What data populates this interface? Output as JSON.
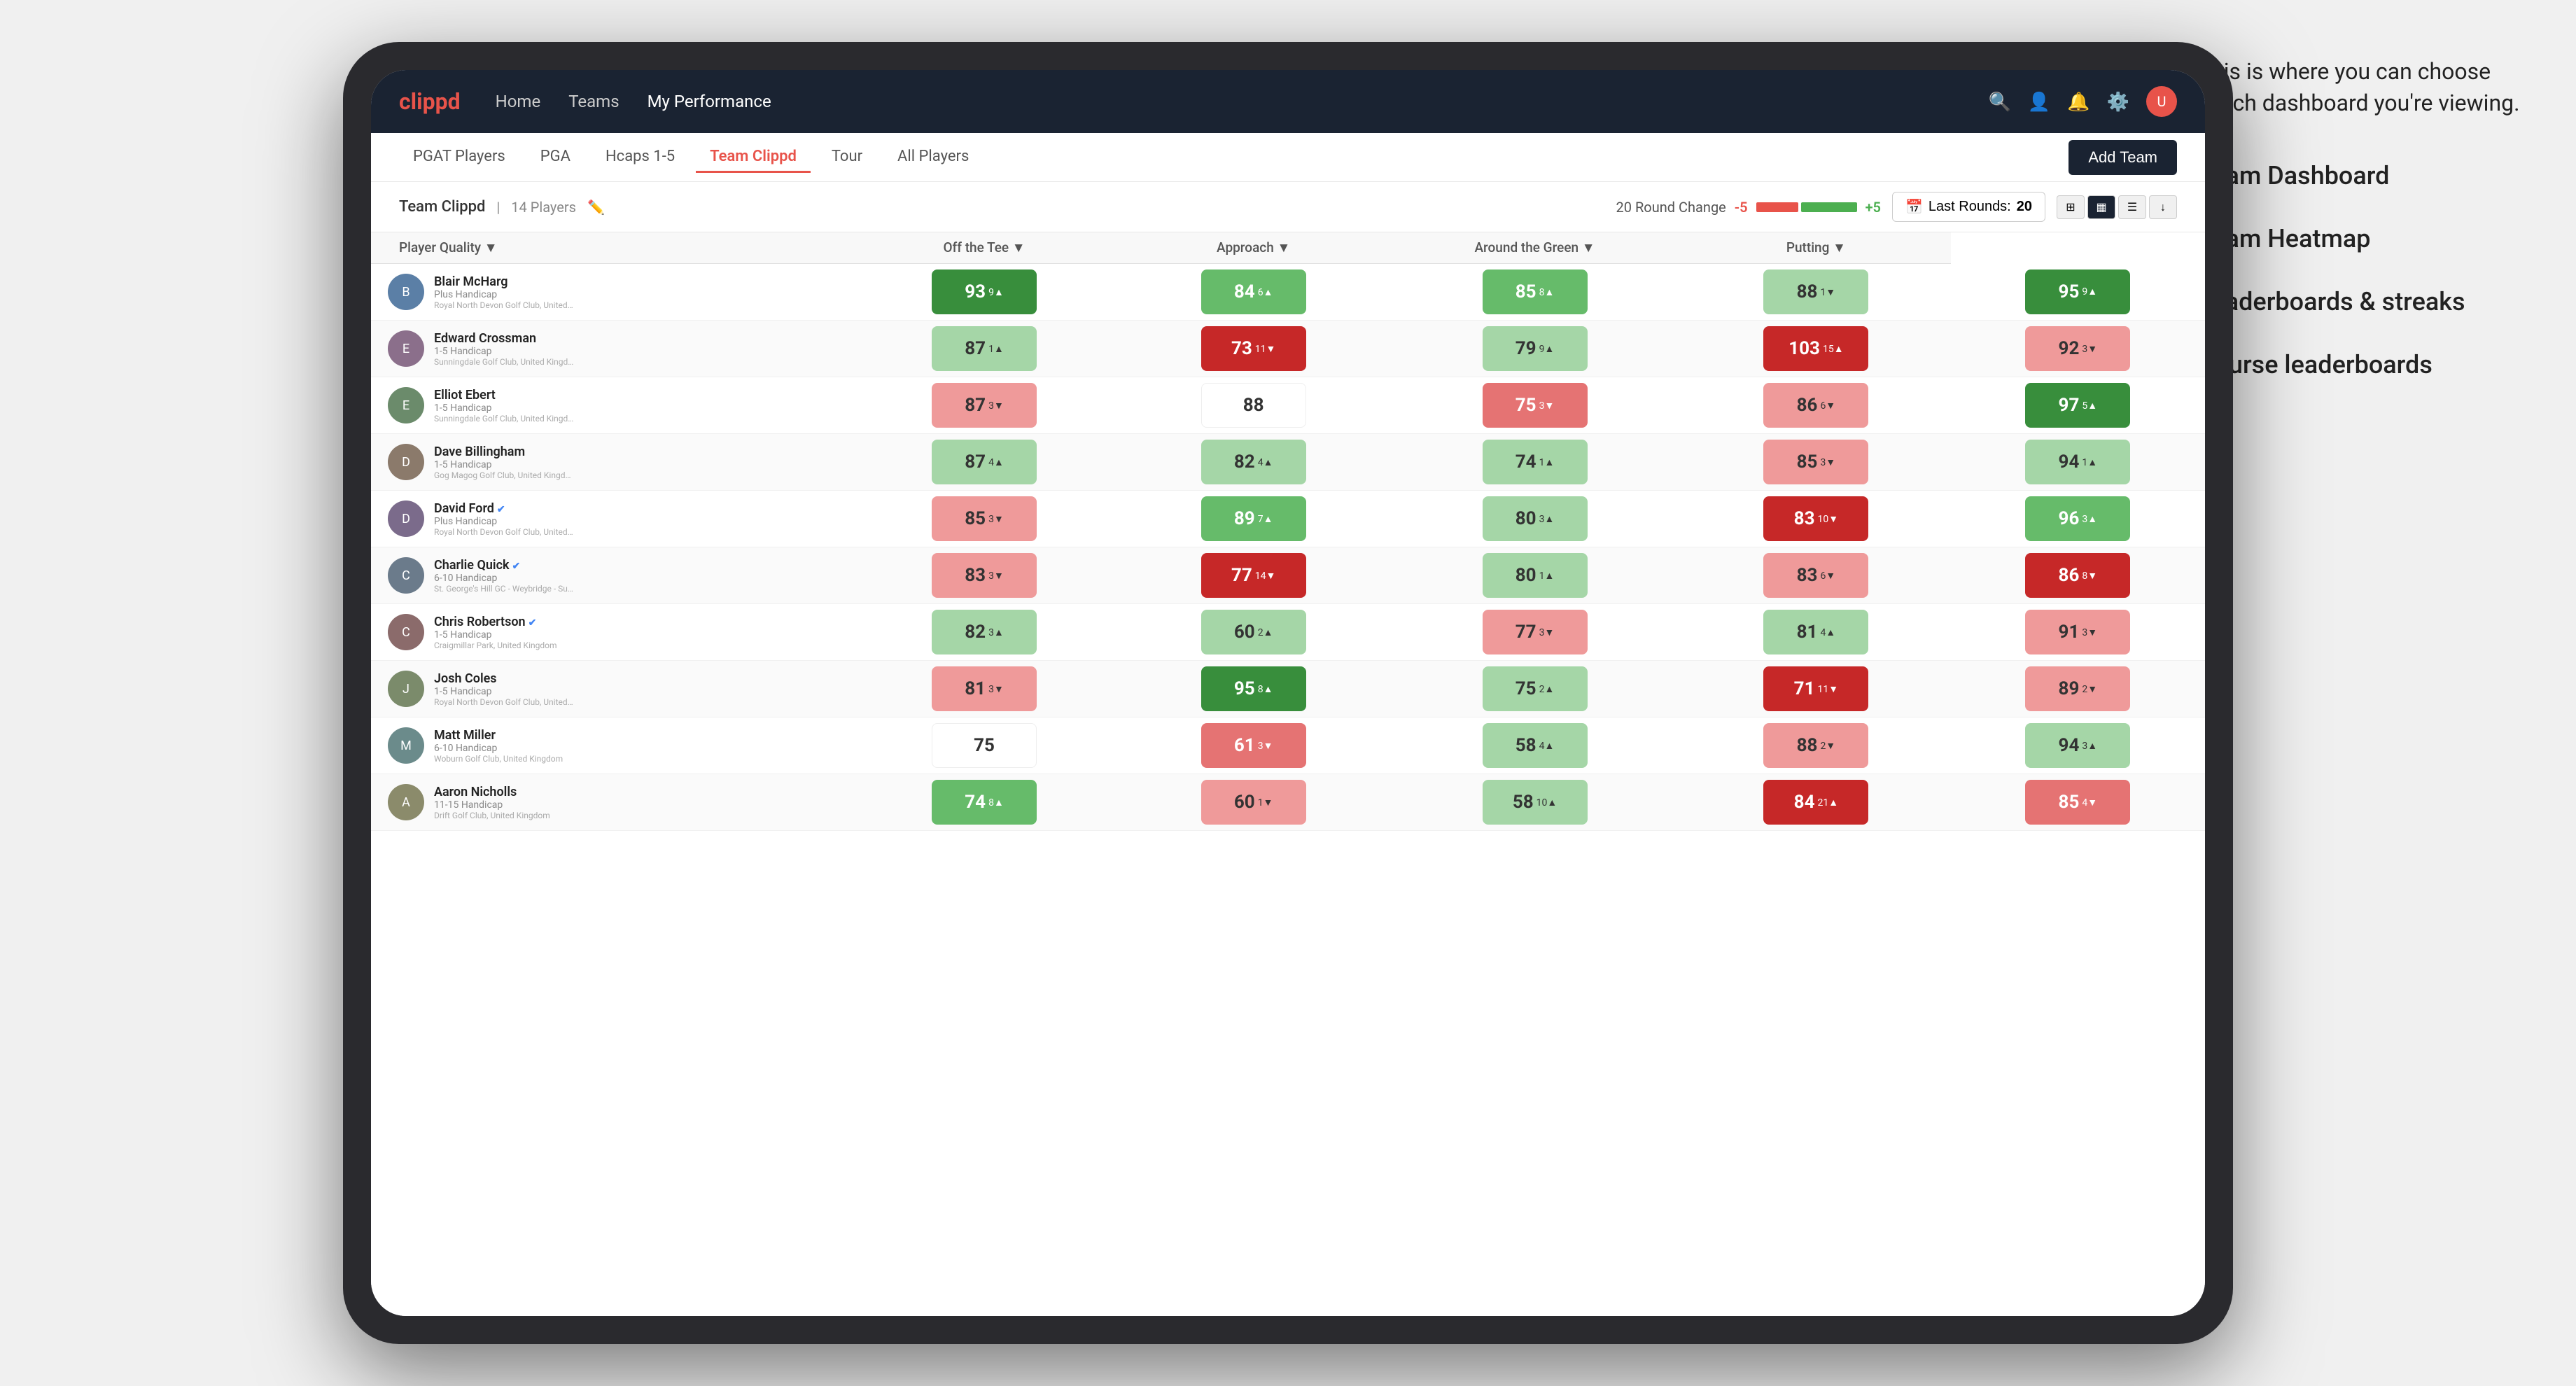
{
  "annotation": {
    "callout": "This is where you can choose which dashboard you're viewing.",
    "items": [
      "Team Dashboard",
      "Team Heatmap",
      "Leaderboards & streaks",
      "Course leaderboards"
    ]
  },
  "nav": {
    "logo": "clippd",
    "links": [
      "Home",
      "Teams",
      "My Performance"
    ],
    "active_link": "My Performance"
  },
  "sub_nav": {
    "tabs": [
      "PGAT Players",
      "PGA",
      "Hcaps 1-5",
      "Team Clippd",
      "Tour",
      "All Players"
    ],
    "active_tab": "Team Clippd",
    "add_team_label": "Add Team"
  },
  "team_header": {
    "name": "Team Clippd",
    "separator": "|",
    "count": "14 Players",
    "round_change_label": "20 Round Change",
    "round_change_neg": "-5",
    "round_change_pos": "+5",
    "last_rounds_label": "Last Rounds:",
    "last_rounds_value": "20"
  },
  "table": {
    "columns": [
      "Player Quality ▼",
      "Off the Tee ▼",
      "Approach ▼",
      "Around the Green ▼",
      "Putting ▼"
    ],
    "player_col": "Player Quality ▼",
    "rows": [
      {
        "name": "Blair McHarg",
        "handicap": "Plus Handicap",
        "club": "Royal North Devon Golf Club, United Kingdom",
        "metrics": [
          {
            "value": "93",
            "change": "9",
            "dir": "up",
            "color": "green-dark"
          },
          {
            "value": "84",
            "change": "6",
            "dir": "up",
            "color": "green-med"
          },
          {
            "value": "85",
            "change": "8",
            "dir": "up",
            "color": "green-med"
          },
          {
            "value": "88",
            "change": "1",
            "dir": "down",
            "color": "green-light"
          },
          {
            "value": "95",
            "change": "9",
            "dir": "up",
            "color": "green-dark"
          }
        ]
      },
      {
        "name": "Edward Crossman",
        "handicap": "1-5 Handicap",
        "club": "Sunningdale Golf Club, United Kingdom",
        "metrics": [
          {
            "value": "87",
            "change": "1",
            "dir": "up",
            "color": "green-light"
          },
          {
            "value": "73",
            "change": "11",
            "dir": "down",
            "color": "red-dark"
          },
          {
            "value": "79",
            "change": "9",
            "dir": "up",
            "color": "green-light"
          },
          {
            "value": "103",
            "change": "15",
            "dir": "up",
            "color": "red-dark"
          },
          {
            "value": "92",
            "change": "3",
            "dir": "down",
            "color": "red-light"
          }
        ]
      },
      {
        "name": "Elliot Ebert",
        "handicap": "1-5 Handicap",
        "club": "Sunningdale Golf Club, United Kingdom",
        "metrics": [
          {
            "value": "87",
            "change": "3",
            "dir": "down",
            "color": "red-light"
          },
          {
            "value": "88",
            "change": "",
            "dir": "",
            "color": "white-cell"
          },
          {
            "value": "75",
            "change": "3",
            "dir": "down",
            "color": "red-med"
          },
          {
            "value": "86",
            "change": "6",
            "dir": "down",
            "color": "red-light"
          },
          {
            "value": "97",
            "change": "5",
            "dir": "up",
            "color": "green-dark"
          }
        ]
      },
      {
        "name": "Dave Billingham",
        "handicap": "1-5 Handicap",
        "club": "Gog Magog Golf Club, United Kingdom",
        "metrics": [
          {
            "value": "87",
            "change": "4",
            "dir": "up",
            "color": "green-light"
          },
          {
            "value": "82",
            "change": "4",
            "dir": "up",
            "color": "green-light"
          },
          {
            "value": "74",
            "change": "1",
            "dir": "up",
            "color": "green-light"
          },
          {
            "value": "85",
            "change": "3",
            "dir": "down",
            "color": "red-light"
          },
          {
            "value": "94",
            "change": "1",
            "dir": "up",
            "color": "green-light"
          }
        ]
      },
      {
        "name": "David Ford",
        "verified": true,
        "handicap": "Plus Handicap",
        "club": "Royal North Devon Golf Club, United Kingdom",
        "metrics": [
          {
            "value": "85",
            "change": "3",
            "dir": "down",
            "color": "red-light"
          },
          {
            "value": "89",
            "change": "7",
            "dir": "up",
            "color": "green-med"
          },
          {
            "value": "80",
            "change": "3",
            "dir": "up",
            "color": "green-light"
          },
          {
            "value": "83",
            "change": "10",
            "dir": "down",
            "color": "red-dark"
          },
          {
            "value": "96",
            "change": "3",
            "dir": "up",
            "color": "green-med"
          }
        ]
      },
      {
        "name": "Charlie Quick",
        "verified": true,
        "handicap": "6-10 Handicap",
        "club": "St. George's Hill GC - Weybridge - Surrey, Uni...",
        "metrics": [
          {
            "value": "83",
            "change": "3",
            "dir": "down",
            "color": "red-light"
          },
          {
            "value": "77",
            "change": "14",
            "dir": "down",
            "color": "red-dark"
          },
          {
            "value": "80",
            "change": "1",
            "dir": "up",
            "color": "green-light"
          },
          {
            "value": "83",
            "change": "6",
            "dir": "down",
            "color": "red-light"
          },
          {
            "value": "86",
            "change": "8",
            "dir": "down",
            "color": "red-dark"
          }
        ]
      },
      {
        "name": "Chris Robertson",
        "verified": true,
        "handicap": "1-5 Handicap",
        "club": "Craigmillar Park, United Kingdom",
        "metrics": [
          {
            "value": "82",
            "change": "3",
            "dir": "up",
            "color": "green-light"
          },
          {
            "value": "60",
            "change": "2",
            "dir": "up",
            "color": "green-light"
          },
          {
            "value": "77",
            "change": "3",
            "dir": "down",
            "color": "red-light"
          },
          {
            "value": "81",
            "change": "4",
            "dir": "up",
            "color": "green-light"
          },
          {
            "value": "91",
            "change": "3",
            "dir": "down",
            "color": "red-light"
          }
        ]
      },
      {
        "name": "Josh Coles",
        "handicap": "1-5 Handicap",
        "club": "Royal North Devon Golf Club, United Kingdom",
        "metrics": [
          {
            "value": "81",
            "change": "3",
            "dir": "down",
            "color": "red-light"
          },
          {
            "value": "95",
            "change": "8",
            "dir": "up",
            "color": "green-dark"
          },
          {
            "value": "75",
            "change": "2",
            "dir": "up",
            "color": "green-light"
          },
          {
            "value": "71",
            "change": "11",
            "dir": "down",
            "color": "red-dark"
          },
          {
            "value": "89",
            "change": "2",
            "dir": "down",
            "color": "red-light"
          }
        ]
      },
      {
        "name": "Matt Miller",
        "handicap": "6-10 Handicap",
        "club": "Woburn Golf Club, United Kingdom",
        "metrics": [
          {
            "value": "75",
            "change": "",
            "dir": "",
            "color": "white-cell"
          },
          {
            "value": "61",
            "change": "3",
            "dir": "down",
            "color": "red-med"
          },
          {
            "value": "58",
            "change": "4",
            "dir": "up",
            "color": "green-light"
          },
          {
            "value": "88",
            "change": "2",
            "dir": "down",
            "color": "red-light"
          },
          {
            "value": "94",
            "change": "3",
            "dir": "up",
            "color": "green-light"
          }
        ]
      },
      {
        "name": "Aaron Nicholls",
        "handicap": "11-15 Handicap",
        "club": "Drift Golf Club, United Kingdom",
        "metrics": [
          {
            "value": "74",
            "change": "8",
            "dir": "up",
            "color": "green-med"
          },
          {
            "value": "60",
            "change": "1",
            "dir": "down",
            "color": "red-light"
          },
          {
            "value": "58",
            "change": "10",
            "dir": "up",
            "color": "green-light"
          },
          {
            "value": "84",
            "change": "21",
            "dir": "up",
            "color": "red-dark"
          },
          {
            "value": "85",
            "change": "4",
            "dir": "down",
            "color": "red-med"
          }
        ]
      }
    ]
  }
}
